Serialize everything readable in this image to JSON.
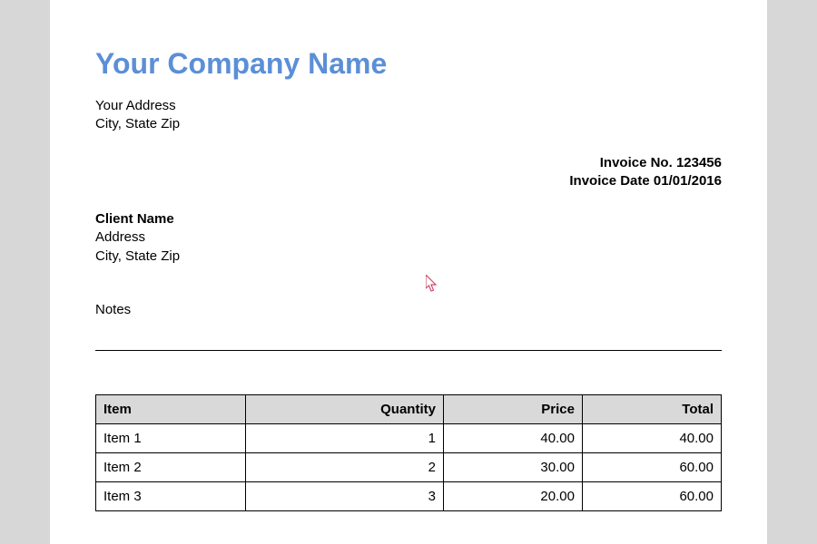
{
  "company": {
    "name": "Your Company Name",
    "address_line1": "Your Address",
    "address_line2": "City, State Zip"
  },
  "invoice_meta": {
    "number_label": "Invoice No.",
    "number": "123456",
    "date_label": "Invoice Date",
    "date": "01/01/2016"
  },
  "client": {
    "name": "Client Name",
    "address_line1": "Address",
    "address_line2": "City, State Zip"
  },
  "notes_label": "Notes",
  "table": {
    "headers": {
      "item": "Item",
      "quantity": "Quantity",
      "price": "Price",
      "total": "Total"
    },
    "rows": [
      {
        "item": "Item 1",
        "quantity": "1",
        "price": "40.00",
        "total": "40.00"
      },
      {
        "item": "Item 2",
        "quantity": "2",
        "price": "30.00",
        "total": "60.00"
      },
      {
        "item": "Item 3",
        "quantity": "3",
        "price": "20.00",
        "total": "60.00"
      }
    ]
  }
}
